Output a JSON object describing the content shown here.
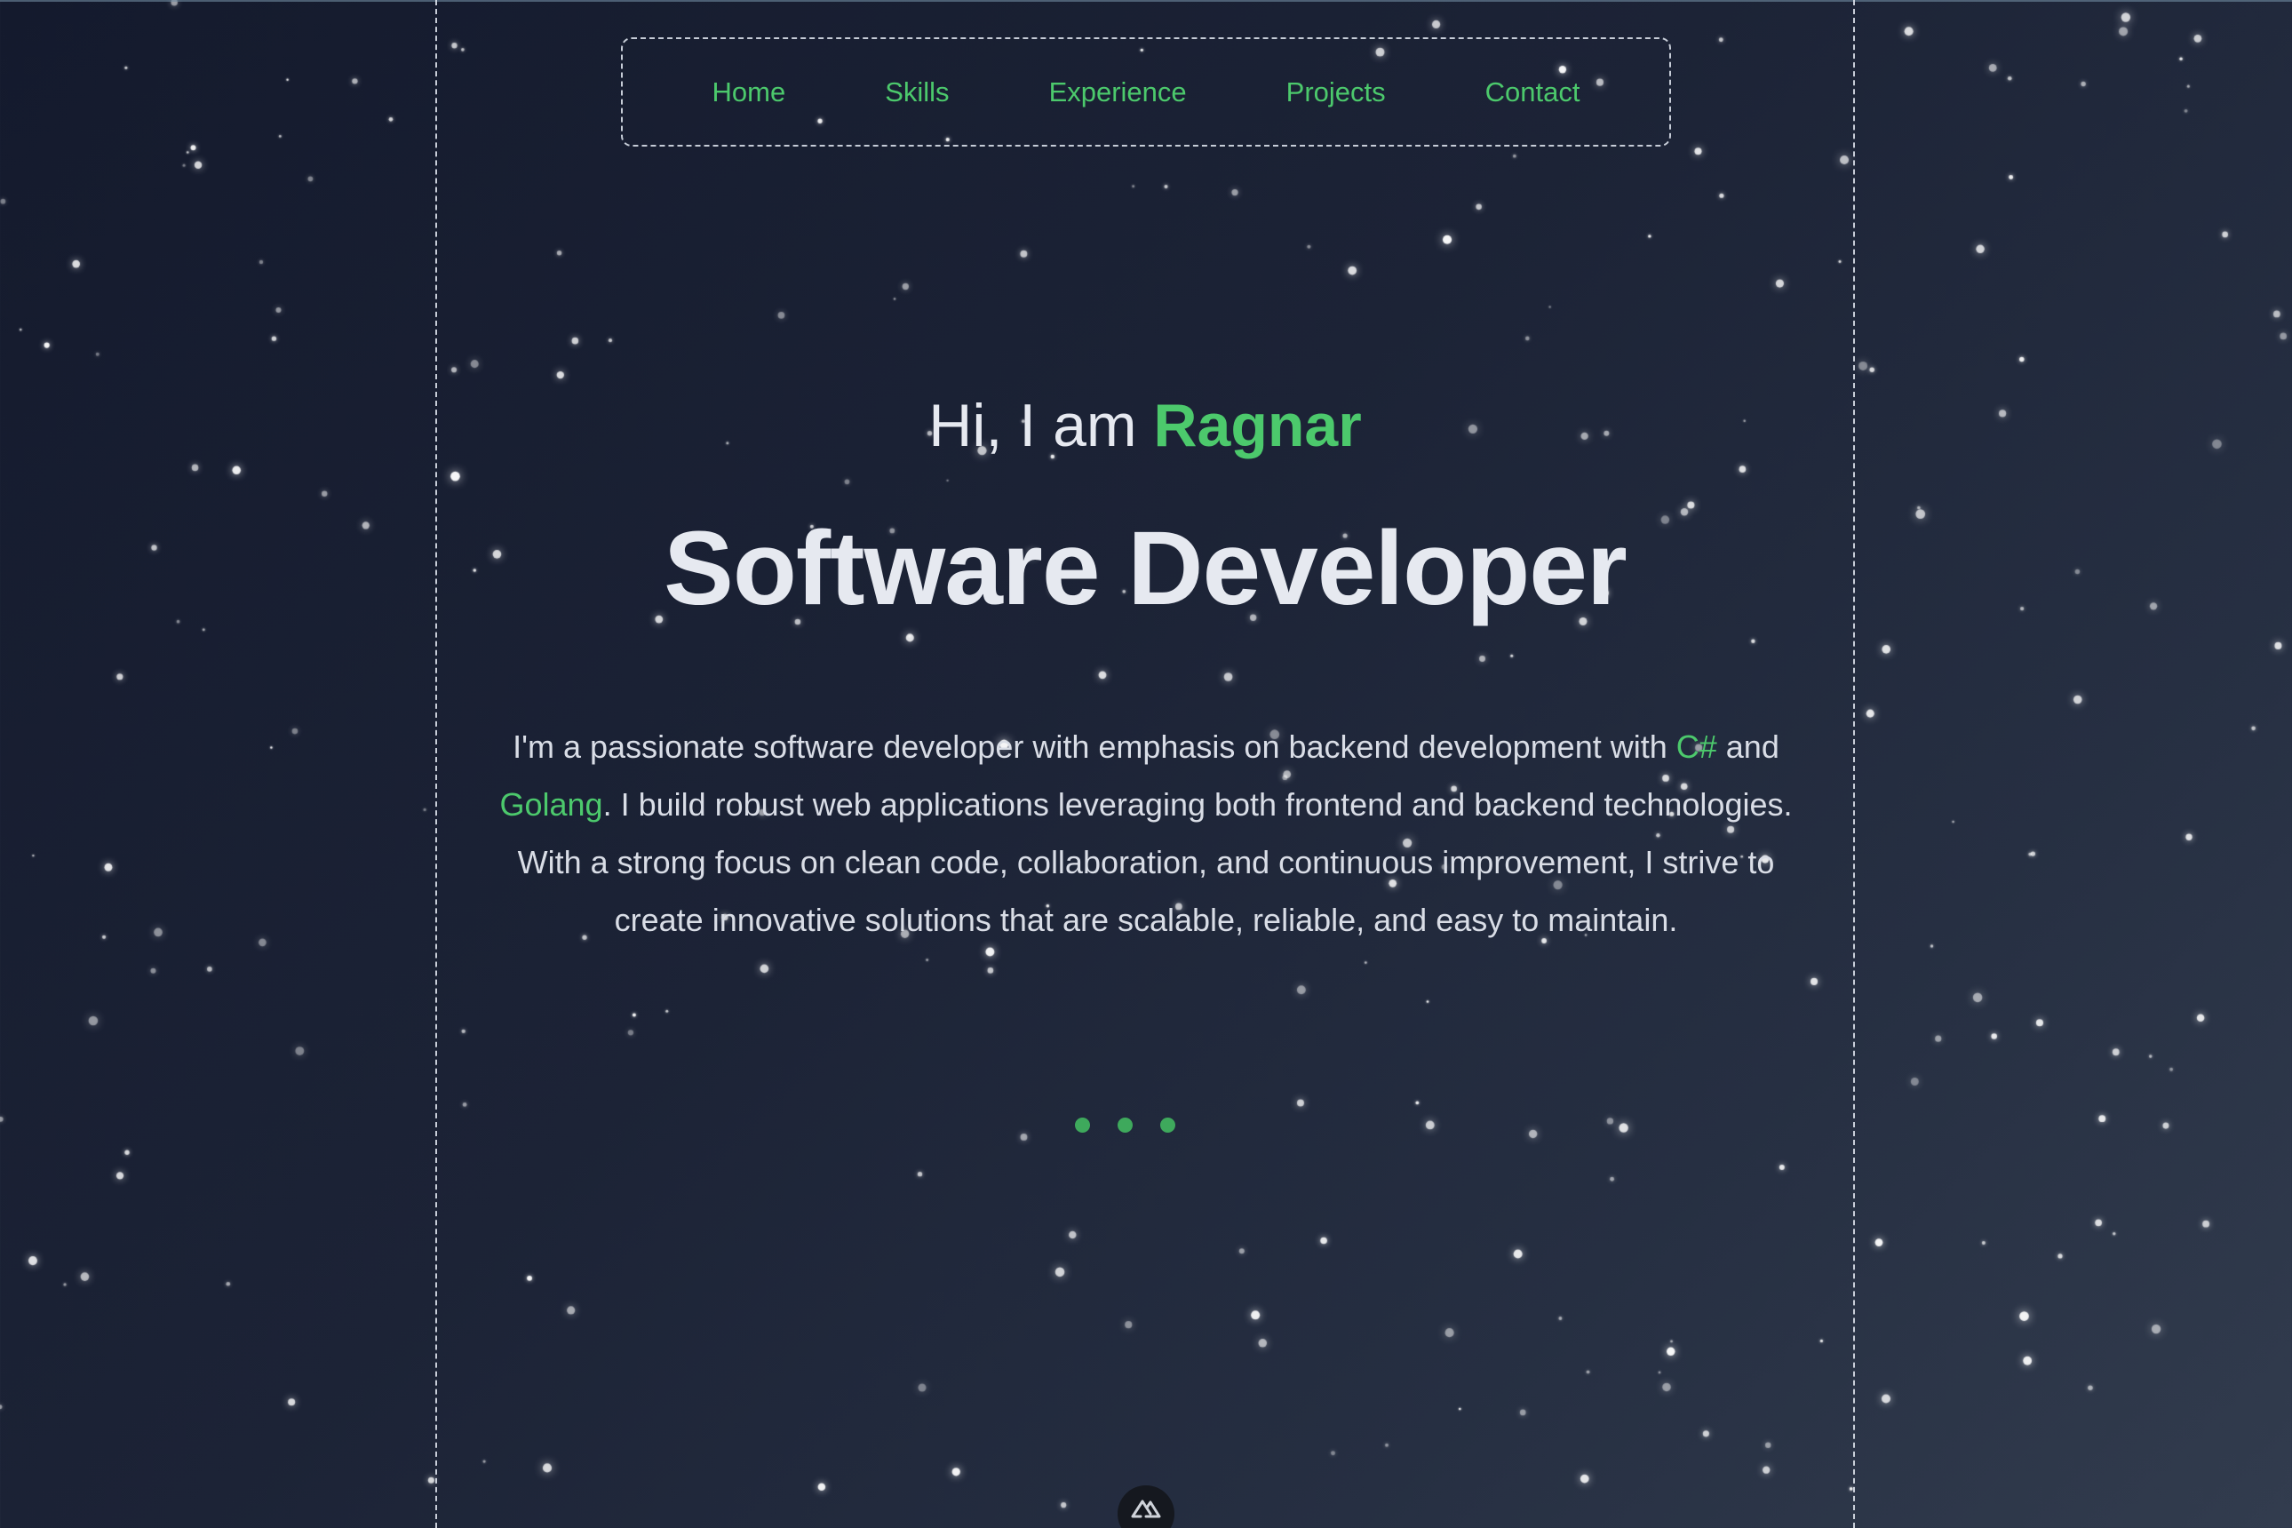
{
  "nav": {
    "items": [
      {
        "label": "Home"
      },
      {
        "label": "Skills"
      },
      {
        "label": "Experience"
      },
      {
        "label": "Projects"
      },
      {
        "label": "Contact"
      }
    ]
  },
  "hero": {
    "greeting_prefix": "Hi, I am ",
    "name": "Ragnar",
    "title": "Software Developer",
    "bio": {
      "part1": "I'm a passionate software developer with emphasis on backend development with ",
      "lang1": "C#",
      "part2": " and ",
      "lang2": "Golang",
      "part3": ". I build robust web applications leveraging both frontend and backend technologies. With a strong focus on clean code, collaboration, and continuous improvement, I strive to create innovative solutions that are scalable, reliable, and easy to maintain."
    }
  },
  "colors": {
    "accent": "#4cc96c",
    "text": "#e6e9f0",
    "background_start": "#141a2d",
    "background_end": "#323c4e"
  },
  "loader": {
    "dots": 3
  },
  "badge": {
    "icon": "nuxt-logo-icon"
  }
}
